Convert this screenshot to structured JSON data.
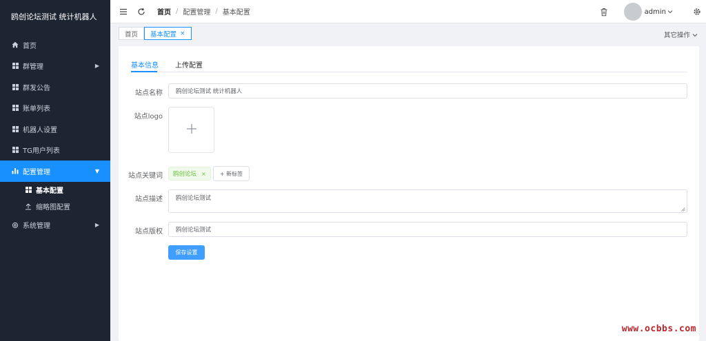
{
  "brand": {
    "title": "鸥创论坛测试 统计机器人"
  },
  "sidebar": {
    "items": [
      {
        "label": "首页"
      },
      {
        "label": "群管理"
      },
      {
        "label": "群发公告"
      },
      {
        "label": "账单列表"
      },
      {
        "label": "机器人设置"
      },
      {
        "label": "TG用户列表"
      },
      {
        "label": "配置管理"
      },
      {
        "label": "系统管理"
      }
    ],
    "sub_items": [
      {
        "label": "基本配置"
      },
      {
        "label": "缩略图配置"
      }
    ]
  },
  "breadcrumb": {
    "home": "首页",
    "level1": "配置管理",
    "level2": "基本配置"
  },
  "user": {
    "name": "admin"
  },
  "tags_view": {
    "tabs": [
      {
        "label": "首页"
      },
      {
        "label": "基本配置"
      }
    ],
    "close_glyph": "×",
    "other_ops": "其它操作"
  },
  "form_tabs": [
    {
      "label": "基本信息"
    },
    {
      "label": "上传配置"
    }
  ],
  "form": {
    "site_name_label": "站点名称",
    "site_name_value": "鸥创论坛测试 统计机器人",
    "logo_label": "站点logo",
    "keywords_label": "站点关键词",
    "keyword_tag": "鸥创论坛",
    "new_tag_label": "+ 新标签",
    "desc_label": "站点描述",
    "desc_value": "鸥创论坛测试",
    "copyright_label": "站点版权",
    "copyright_value": "鸥创论坛测试",
    "save_label": "保存设置"
  },
  "watermark": "www.ocbbs.com",
  "colors": {
    "sidebar_bg": "#1e2532",
    "accent": "#1890ff",
    "button": "#409eff",
    "tag_green": "#67c23a",
    "watermark": "#b8272c"
  },
  "icons": [
    "home-icon",
    "grid-icon",
    "chart-icon",
    "upload-icon",
    "gear-icon",
    "hamburger-icon",
    "refresh-icon",
    "trash-icon",
    "settings-icon",
    "plus-icon"
  ]
}
